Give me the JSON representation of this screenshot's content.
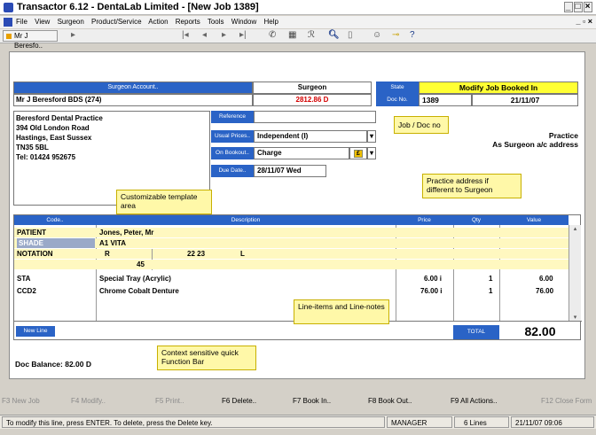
{
  "window": {
    "title": "Transactor 6.12 - DentaLab Limited - [New Job 1389]"
  },
  "menu": {
    "items": [
      "File",
      "View",
      "Surgeon",
      "Product/Service",
      "Action",
      "Reports",
      "Tools",
      "Window",
      "Help"
    ]
  },
  "toolbar": {
    "tab_label": "Mr J Beresfo.."
  },
  "account": {
    "header": "Surgeon Account..",
    "name": "Mr J Beresford  BDS (274)",
    "address_lines": [
      "Beresford Dental Practice",
      "394 Old London Road",
      "Hastings, East Sussex",
      "TN35 5BL",
      "Tel: 01424 952675"
    ]
  },
  "surgeon": {
    "header": "Surgeon",
    "balance": "2812.86 D"
  },
  "state": {
    "label": "State",
    "value": "Modify Job Booked In",
    "docno_label": "Doc No.",
    "docno": "1389",
    "date": "21/11/07"
  },
  "practice": {
    "line1": "Practice",
    "line2": "As Surgeon a/c address"
  },
  "fields": {
    "reference_label": "Reference",
    "reference": "",
    "usual_prices_label": "Usual Prices..",
    "usual_prices": "Independent (I)",
    "on_booking_label": "On Bookout..",
    "on_booking": "Charge",
    "due_date_label": "Due Date..",
    "due_date": "28/11/07  Wed"
  },
  "notes": {
    "job_doc": "Job / Doc no",
    "practice_addr": "Practice address if different to Surgeon",
    "template": "Customizable template area",
    "lines": "Line-items and Line-notes",
    "fbar": "Context sensitive quick Function Bar"
  },
  "grid": {
    "columns": [
      "Code..",
      "Description",
      "Price",
      "Qty",
      "Value"
    ],
    "rows": [
      {
        "code": "PATIENT",
        "desc": "Jones, Peter, Mr",
        "price": "",
        "qty": "",
        "value": ""
      },
      {
        "code": "SHADE",
        "desc": "A1 VITA",
        "price": "",
        "qty": "",
        "value": ""
      },
      {
        "code": "NOTATION",
        "desc": "R",
        "mid": "22 23",
        "right": "L",
        "price": "",
        "qty": "",
        "value": ""
      },
      {
        "code": "",
        "desc": "45",
        "price": "",
        "qty": "",
        "value": ""
      },
      {
        "code": "STA",
        "desc": "Special Tray (Acrylic)",
        "price": "6.00 i",
        "qty": "1",
        "value": "6.00"
      },
      {
        "code": "CCD2",
        "desc": "Chrome Cobalt Denture",
        "price": "76.00 i",
        "qty": "1",
        "value": "76.00"
      }
    ],
    "new_line": "New Line",
    "total_label": "TOTAL",
    "total": "82.00"
  },
  "doc_balance": "Doc Balance: 82.00 D",
  "fkeys": [
    "F3 New Job",
    "F4 Modify..",
    "F5 Print..",
    "F6 Delete..",
    "F7 Book In..",
    "F8 Book Out..",
    "F9 All Actions..",
    "F12 Close Form"
  ],
  "status": {
    "hint": "To modify this line, press ENTER. To delete, press the Delete key.",
    "user": "MANAGER",
    "lines": "6 Lines",
    "datetime": "21/11/07  09:06"
  }
}
